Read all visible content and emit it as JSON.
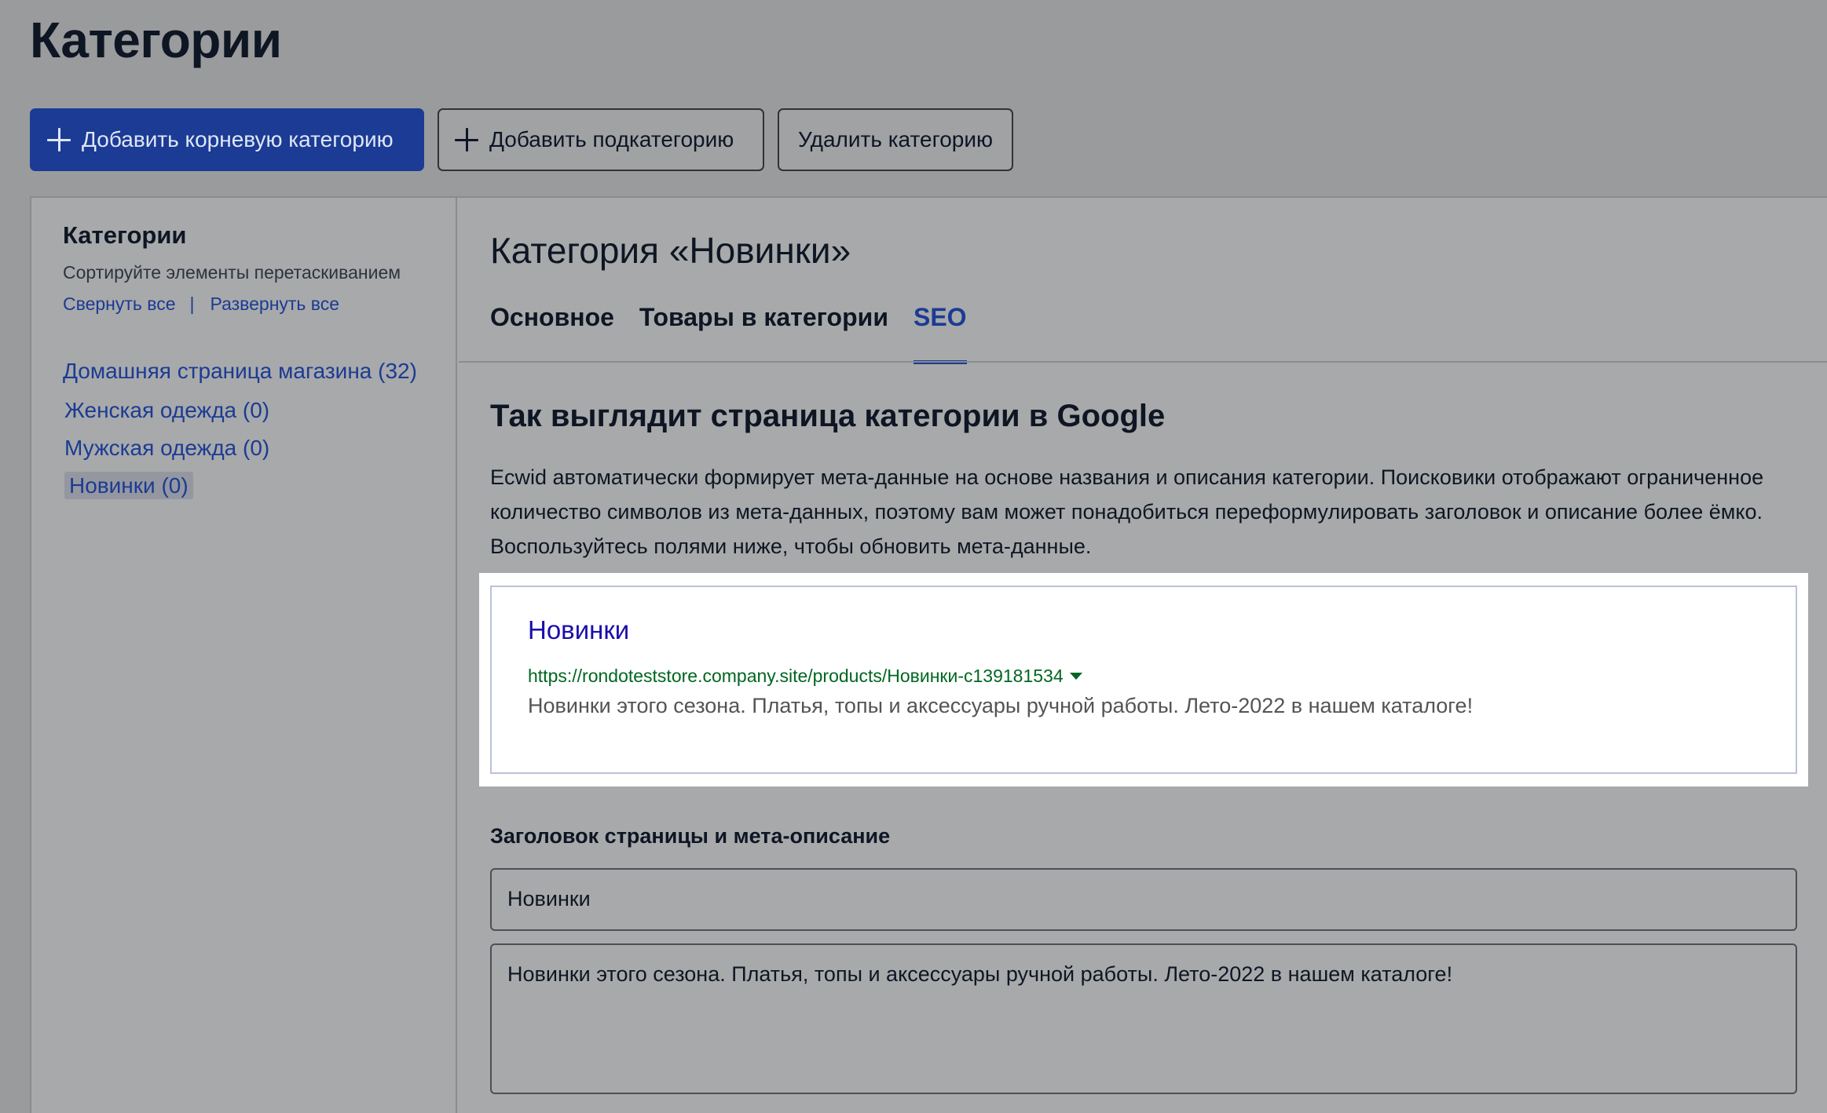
{
  "header": {
    "title": "Категории"
  },
  "toolbar": {
    "add_root_label": "Добавить корневую категорию",
    "add_sub_label": "Добавить подкатегорию",
    "delete_label": "Удалить категорию"
  },
  "sidebar": {
    "title": "Категории",
    "hint": "Сортируйте элементы перетаскиванием",
    "collapse_all": "Свернуть все",
    "separator": "|",
    "expand_all": "Развернуть все",
    "items": [
      {
        "label": "Домашняя страница магазина (32)"
      },
      {
        "label": "Женская одежда (0)"
      },
      {
        "label": "Мужская одежда (0)"
      },
      {
        "label": "Новинки (0)",
        "selected": true
      }
    ]
  },
  "main": {
    "category_title": "Категория «Новинки»",
    "tabs": [
      {
        "label": "Основное"
      },
      {
        "label": "Товары в категории"
      },
      {
        "label": "SEO",
        "active": true
      }
    ],
    "seo_heading": "Так выглядит страница категории в Google",
    "seo_description": "Ecwid автоматически формирует мета-данные на основе названия и описания категории. Поисковики отображают ограниченное количество символов из мета-данных, поэтому вам может понадобиться переформулировать заголовок и описание более ёмко. Воспользуйтесь полями ниже, чтобы обновить мета-данные."
  },
  "preview": {
    "title": "Новинки",
    "url": "https://rondoteststore.company.site/products/Новинки-c139181534",
    "description": "Новинки этого сезона. Платья, топы и аксессуары ручной работы. Лето-2022 в нашем каталоге!"
  },
  "form": {
    "label": "Заголовок страницы и мета-описание",
    "title_value": "Новинки",
    "description_value": "Новинки этого сезона. Платья, топы и аксессуары ручной работы. Лето-2022 в нашем каталоге!"
  },
  "colors": {
    "accent": "#1b3b94",
    "google_link": "#1a0dab",
    "google_url": "#006621",
    "overlay_bg": "#9a9b9d"
  },
  "icons": {
    "plus": "plus-icon",
    "dropdown_caret": "caret-down-icon"
  }
}
